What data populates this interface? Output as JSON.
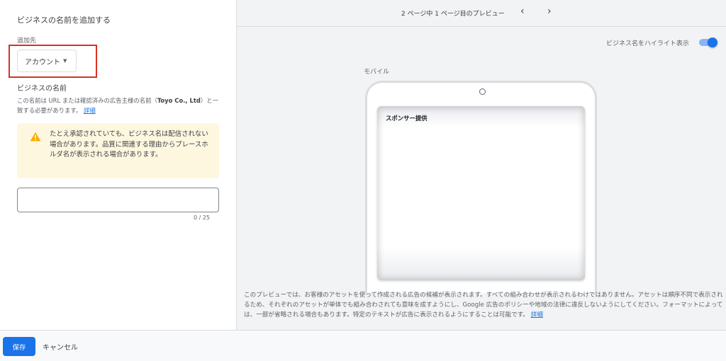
{
  "left": {
    "section_title": "ビジネスの名前を追加する",
    "add_to_label": "追加先",
    "account_button": "アカウント",
    "business_name_title": "ビジネスの名前",
    "description_prefix": "この名前は URL または確認済みの広告主様の名前（",
    "description_company": "Toyo Co., Ltd",
    "description_suffix": "）と一致する必要があります。",
    "description_link": "詳細",
    "warning_text": "たとえ承認されていても、ビジネス名は配信されない場合があります。品質に関連する理由からプレースホルダ名が表示される場合があります。",
    "name_input_value": "",
    "counter": "0 / 25"
  },
  "preview": {
    "pager_text": "2 ページ中 1 ページ目のプレビュー",
    "prev_label": "‹",
    "next_label": "›",
    "highlight_toggle_label": "ビジネス名をハイライト表示",
    "highlight_toggle_on": true,
    "mobile_label": "モバイル",
    "sponsored_label": "スポンサー提供",
    "note_text": "このプレビューでは、お客様のアセットを使って作成される広告の候補が表示されます。すべての組み合わせが表示されるわけではありません。アセットは順序不同で表示されるため、それぞれのアセットが単体でも組み合わされても意味を成すようにし、Google 広告のポリシーや地域の法律に違反しないようにしてください。フォーマットによっては、一部が省略される場合もあります。特定のテキストが広告に表示されるようにすることは可能です。",
    "note_link": "詳細"
  },
  "footer": {
    "save_label": "保存",
    "cancel_label": "キャンセル"
  },
  "colors": {
    "accent": "#1a73e8",
    "highlight_box": "#d93025",
    "warning_bg": "#fef7e0",
    "warning_icon": "#f9ab00"
  },
  "icons": {
    "warning": "warning-triangle-icon",
    "dropdown": "caret-down-icon",
    "prev": "chevron-left-icon",
    "next": "chevron-right-icon"
  }
}
